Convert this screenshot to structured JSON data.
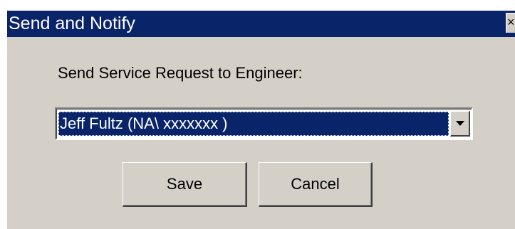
{
  "window": {
    "title": "Send and Notify",
    "close_glyph": "×"
  },
  "form": {
    "prompt": "Send Service Request to Engineer:",
    "engineer_select": {
      "selected_value": "Jeff Fultz (NA\\ xxxxxxx )"
    }
  },
  "buttons": {
    "save_label": "Save",
    "cancel_label": "Cancel"
  },
  "colors": {
    "titlebar": "#0a246a",
    "dialog_face": "#d4d0c8",
    "selection": "#0a246a",
    "title_text": "#ffffff"
  },
  "icons": {
    "close": "close-icon",
    "dropdown": "chevron-down-icon"
  }
}
